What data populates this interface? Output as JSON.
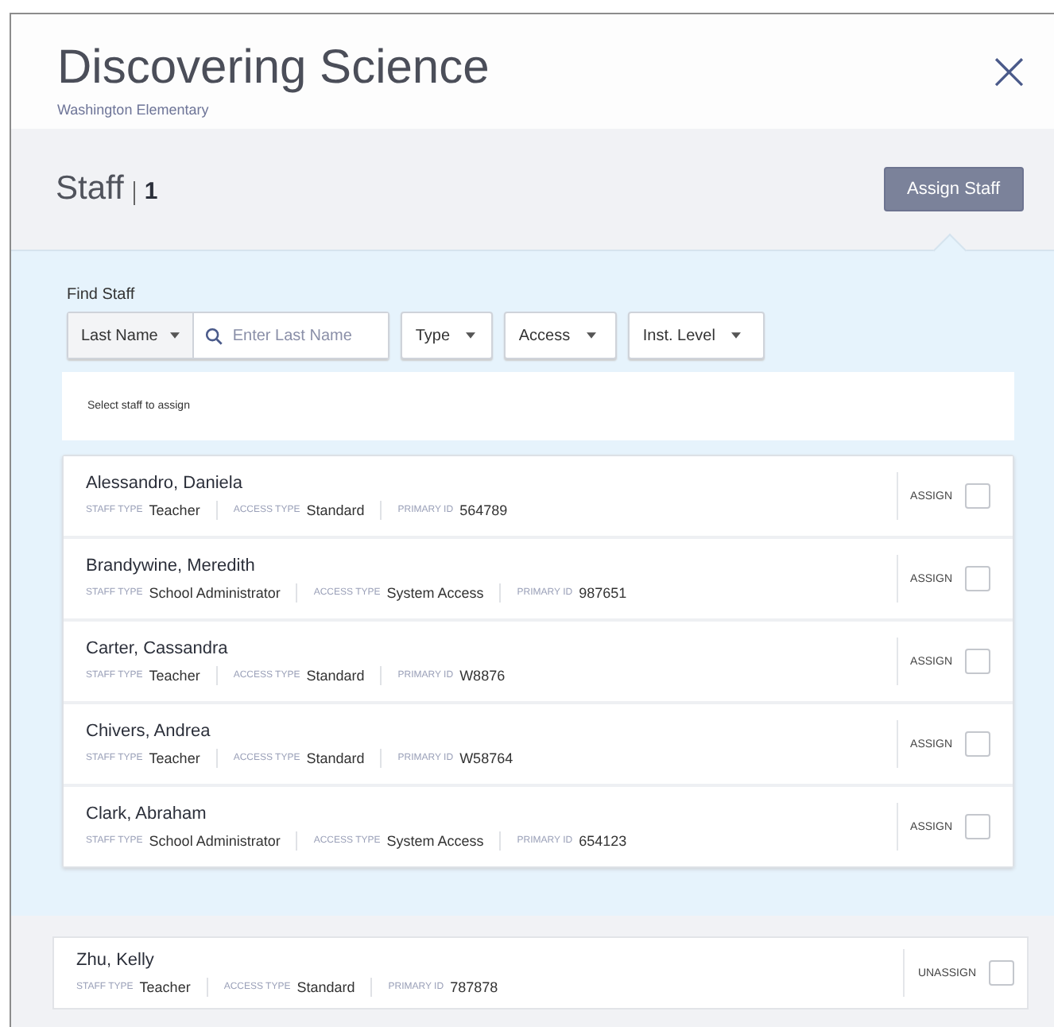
{
  "header": {
    "title": "Discovering Science",
    "subtitle": "Washington Elementary",
    "close": "×"
  },
  "staff_bar": {
    "title": "Staff",
    "count": "1",
    "button": "Assign Staff"
  },
  "find": {
    "label": "Find Staff",
    "search_by": "Last Name",
    "placeholder": "Enter Last Name",
    "filters": [
      "Type",
      "Access",
      "Inst. Level"
    ],
    "hint": "Select staff to assign"
  },
  "available": [
    {
      "name": "Alessandro, Daniela",
      "fields": [
        {
          "label": "STAFF TYPE",
          "value": "Teacher"
        },
        {
          "label": "ACCESS TYPE",
          "value": "Standard"
        },
        {
          "label": "PRIMARY ID",
          "value": "564789"
        }
      ],
      "action": "ASSIGN",
      "checked": false
    },
    {
      "name": "Brandywine, Meredith",
      "fields": [
        {
          "label": "STAFF TYPE",
          "value": "School Administrator"
        },
        {
          "label": "ACCESS TYPE",
          "value": "System Access"
        },
        {
          "label": "PRIMARY ID",
          "value": "987651"
        }
      ],
      "action": "ASSIGN",
      "checked": false
    },
    {
      "name": "Carter, Cassandra",
      "fields": [
        {
          "label": "STAFF TYPE",
          "value": "Teacher"
        },
        {
          "label": "ACCESS TYPE",
          "value": "Standard"
        },
        {
          "label": "PRIMARY ID",
          "value": "W8876"
        }
      ],
      "action": "ASSIGN",
      "checked": false
    },
    {
      "name": "Chivers, Andrea",
      "fields": [
        {
          "label": "STAFF TYPE",
          "value": "Teacher"
        },
        {
          "label": "ACCESS TYPE",
          "value": "Standard"
        },
        {
          "label": "PRIMARY ID",
          "value": "W58764"
        }
      ],
      "action": "ASSIGN",
      "checked": false
    },
    {
      "name": "Clark, Abraham",
      "fields": [
        {
          "label": "STAFF TYPE",
          "value": "School Administrator"
        },
        {
          "label": "ACCESS TYPE",
          "value": "System Access"
        },
        {
          "label": "PRIMARY ID",
          "value": "654123"
        }
      ],
      "action": "ASSIGN",
      "checked": false
    }
  ],
  "assigned": [
    {
      "name": "Zhu, Kelly",
      "fields": [
        {
          "label": "STAFF TYPE",
          "value": "Teacher"
        },
        {
          "label": "ACCESS TYPE",
          "value": "Standard"
        },
        {
          "label": "PRIMARY ID",
          "value": "787878"
        }
      ],
      "action": "UNASSIGN",
      "checked": false
    }
  ]
}
